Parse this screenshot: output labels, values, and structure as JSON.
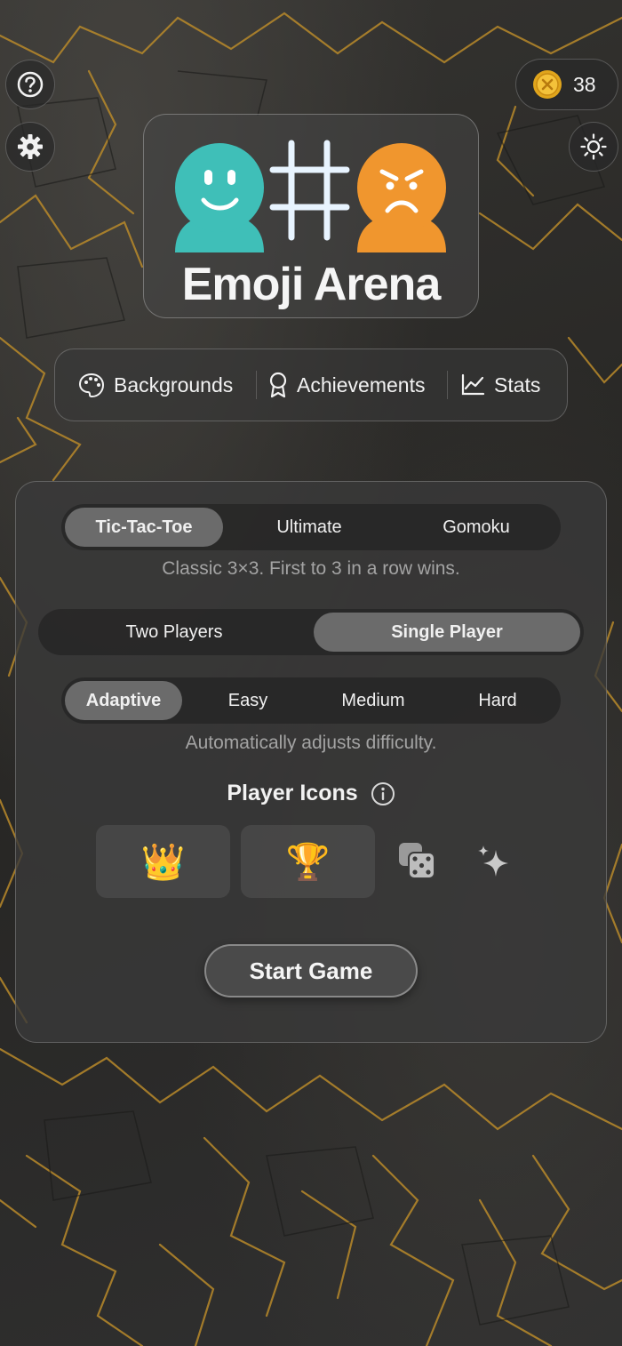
{
  "app": {
    "title": "Emoji Arena"
  },
  "header": {
    "coins": "38",
    "help_icon": "help-icon",
    "settings_icon": "gear-icon",
    "theme_icon": "sun-icon"
  },
  "nav": {
    "items": [
      {
        "label": "Backgrounds",
        "icon": "palette-icon"
      },
      {
        "label": "Achievements",
        "icon": "ribbon-icon"
      },
      {
        "label": "Stats",
        "icon": "chart-icon"
      }
    ]
  },
  "game_modes": {
    "options": [
      "Tic-Tac-Toe",
      "Ultimate",
      "Gomoku"
    ],
    "selected": "Tic-Tac-Toe",
    "description": "Classic 3×3. First to 3 in a row wins."
  },
  "players": {
    "options": [
      "Two Players",
      "Single Player"
    ],
    "selected": "Single Player"
  },
  "difficulty": {
    "options": [
      "Adaptive",
      "Easy",
      "Medium",
      "Hard"
    ],
    "selected": "Adaptive",
    "description": "Automatically adjusts difficulty."
  },
  "player_icons": {
    "title": "Player Icons",
    "player1": "👑",
    "player2": "🏆",
    "extra_icons": [
      "dice-icon",
      "sparkles-icon"
    ]
  },
  "start_button": "Start Game",
  "colors": {
    "teal": "#3fbfb8",
    "orange": "#f0962e",
    "crack_gold": "#b8892a",
    "selected_segment": "#6b6b6b"
  }
}
